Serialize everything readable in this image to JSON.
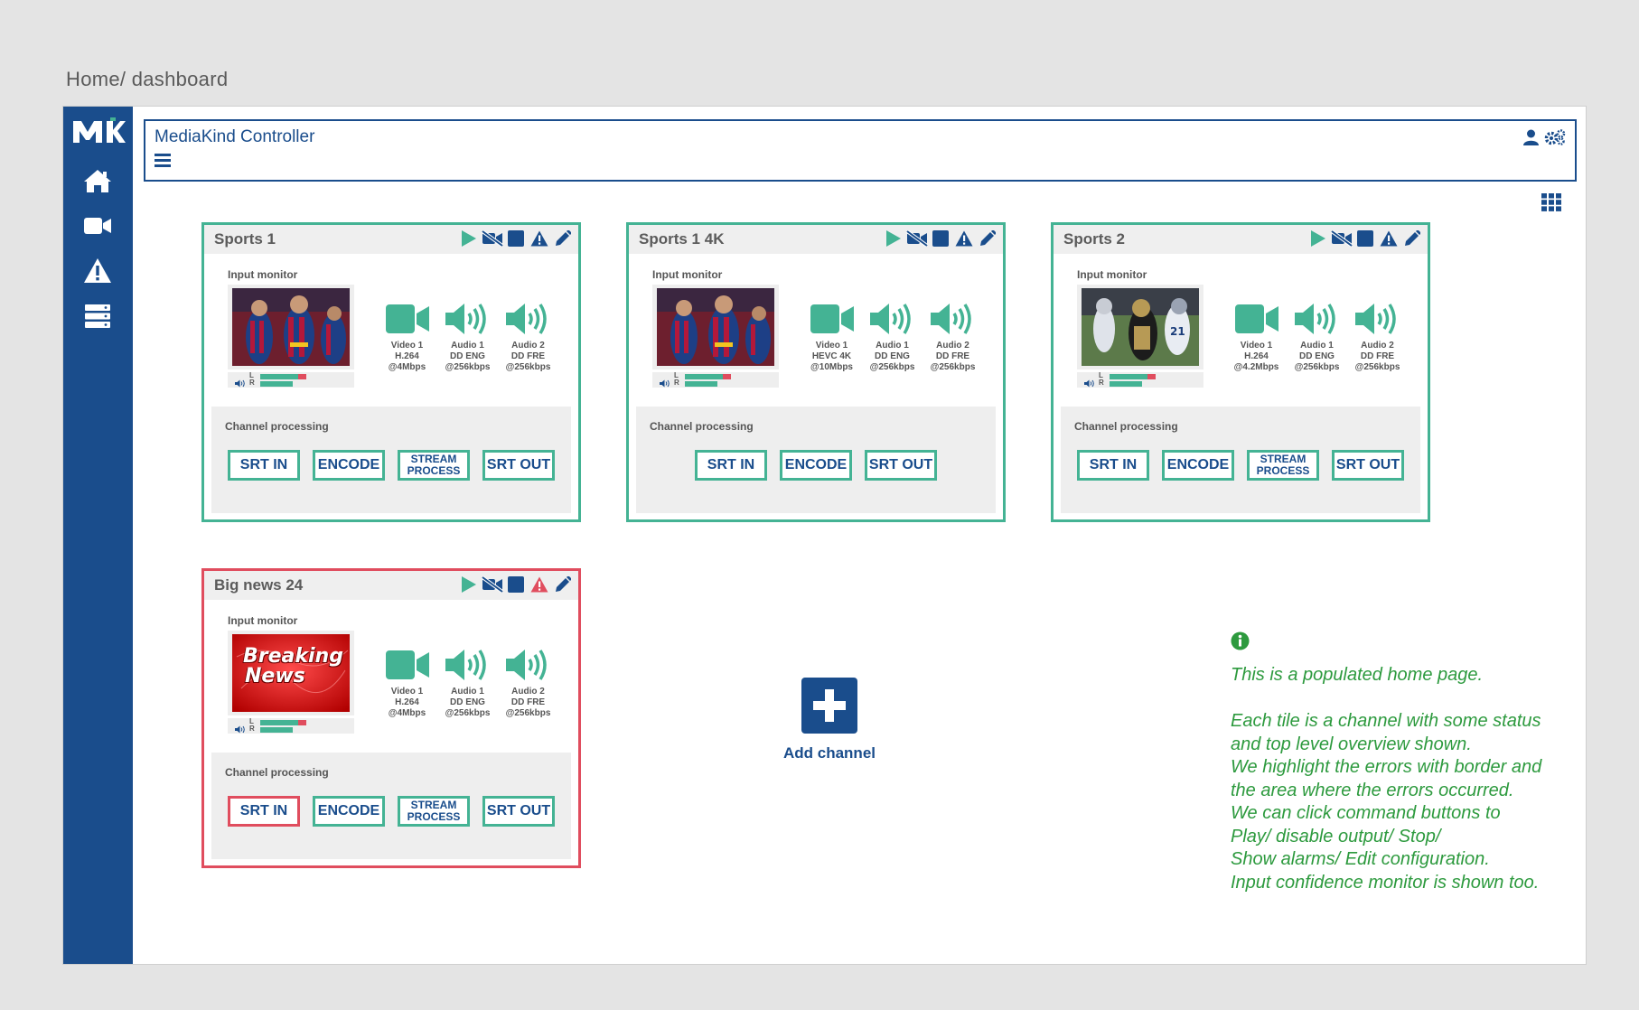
{
  "breadcrumb": "Home/ dashboard",
  "app": {
    "title": "MediaKind Controller",
    "logo_text": "MK"
  },
  "sidebar": {
    "items": [
      {
        "name": "home-icon"
      },
      {
        "name": "video-camera-icon"
      },
      {
        "name": "alert-icon"
      },
      {
        "name": "server-icon"
      }
    ]
  },
  "labels": {
    "input_monitor": "Input monitor",
    "channel_processing": "Channel processing",
    "meter_l": "L",
    "meter_r": "R"
  },
  "channels": [
    {
      "name": "Sports 1",
      "status": "ok",
      "thumbnail": "soccer",
      "meter": {
        "left": 0.85,
        "right": 0.6
      },
      "streams": [
        {
          "type": "video",
          "lines": [
            "Video 1",
            "H.264",
            "@4Mbps"
          ]
        },
        {
          "type": "audio",
          "lines": [
            "Audio 1",
            "DD ENG",
            "@256kbps"
          ]
        },
        {
          "type": "audio",
          "lines": [
            "Audio 2",
            "DD FRE",
            "@256kbps"
          ]
        }
      ],
      "buttons": [
        {
          "label": "SRT IN",
          "error": false
        },
        {
          "label": "ENCODE",
          "error": false
        },
        {
          "label": "STREAM PROCESS",
          "error": false
        },
        {
          "label": "SRT OUT",
          "error": false
        }
      ]
    },
    {
      "name": "Sports 1 4K",
      "status": "ok",
      "thumbnail": "soccer",
      "meter": {
        "left": 0.85,
        "right": 0.6
      },
      "streams": [
        {
          "type": "video",
          "lines": [
            "Video 1",
            "HEVC 4K",
            "@10Mbps"
          ]
        },
        {
          "type": "audio",
          "lines": [
            "Audio 1",
            "DD ENG",
            "@256kbps"
          ]
        },
        {
          "type": "audio",
          "lines": [
            "Audio 2",
            "DD FRE",
            "@256kbps"
          ]
        }
      ],
      "buttons": [
        {
          "label": "SRT IN",
          "error": false
        },
        {
          "label": "ENCODE",
          "error": false
        },
        {
          "label": "SRT OUT",
          "error": false
        }
      ]
    },
    {
      "name": "Sports 2",
      "status": "ok",
      "thumbnail": "football",
      "meter": {
        "left": 0.85,
        "right": 0.6
      },
      "streams": [
        {
          "type": "video",
          "lines": [
            "Video 1",
            "H.264",
            "@4.2Mbps"
          ]
        },
        {
          "type": "audio",
          "lines": [
            "Audio 1",
            "DD ENG",
            "@256kbps"
          ]
        },
        {
          "type": "audio",
          "lines": [
            "Audio 2",
            "DD FRE",
            "@256kbps"
          ]
        }
      ],
      "buttons": [
        {
          "label": "SRT IN",
          "error": false
        },
        {
          "label": "ENCODE",
          "error": false
        },
        {
          "label": "STREAM PROCESS",
          "error": false
        },
        {
          "label": "SRT OUT",
          "error": false
        }
      ]
    },
    {
      "name": "Big news 24",
      "status": "error",
      "thumbnail": "news",
      "thumbnail_text": [
        "Breaking",
        "News"
      ],
      "meter": {
        "left": 0.85,
        "right": 0.6
      },
      "streams": [
        {
          "type": "video",
          "lines": [
            "Video 1",
            "H.264",
            "@4Mbps"
          ]
        },
        {
          "type": "audio",
          "lines": [
            "Audio 1",
            "DD ENG",
            "@256kbps"
          ]
        },
        {
          "type": "audio",
          "lines": [
            "Audio 2",
            "DD FRE",
            "@256kbps"
          ]
        }
      ],
      "buttons": [
        {
          "label": "SRT IN",
          "error": true
        },
        {
          "label": "ENCODE",
          "error": false
        },
        {
          "label": "STREAM PROCESS",
          "error": false
        },
        {
          "label": "SRT OUT",
          "error": false
        }
      ]
    }
  ],
  "add_channel": {
    "label": "Add channel"
  },
  "info": {
    "lines": [
      "This is a populated home page.",
      "",
      "Each tile is a channel with some status",
      "and top level overview shown.",
      "We highlight the errors with border and",
      "the area where the errors occurred.",
      "We can click command buttons to",
      "Play/ disable output/ Stop/",
      "Show alarms/ Edit configuration.",
      "Input confidence monitor is shown too."
    ]
  },
  "colors": {
    "brand_blue": "#1a4d8c",
    "ok_green": "#44b394",
    "error_red": "#e04d5e",
    "info_green": "#2d9a3e"
  }
}
